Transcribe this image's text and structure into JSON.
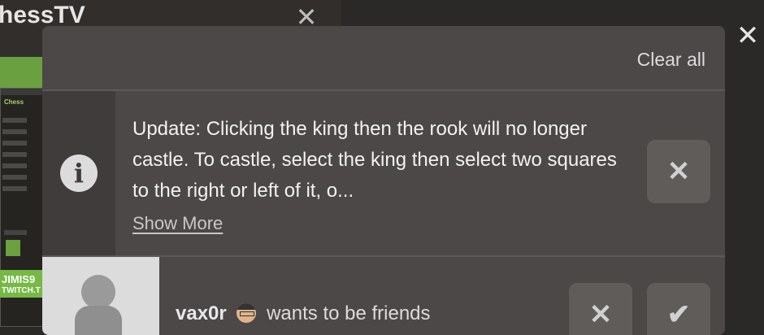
{
  "background_window": {
    "title": "hessTV",
    "banner_line1": "JIMIS9",
    "banner_line2": "TWITCH.T",
    "thumb_logo": "Chess"
  },
  "popup": {
    "clear_all_label": "Clear all",
    "notifications": [
      {
        "type": "info",
        "icon": "info-icon",
        "text": "Update: Clicking the king then the rook will no longer castle. To castle, select the king then select two squares to the right or left of it, o...",
        "show_more_label": "Show More",
        "dismiss_icon": "close-icon"
      },
      {
        "type": "friend-request",
        "username": "vax0r",
        "message": "wants to be friends",
        "avatar_icon": "pawn-icon",
        "decline_icon": "close-icon",
        "accept_icon": "check-icon"
      }
    ]
  },
  "colors": {
    "popup_bg": "#4b4847",
    "icon_column_bg": "#3f3c3b",
    "button_bg": "#5f5c5a",
    "text": "#f2f2f2"
  }
}
